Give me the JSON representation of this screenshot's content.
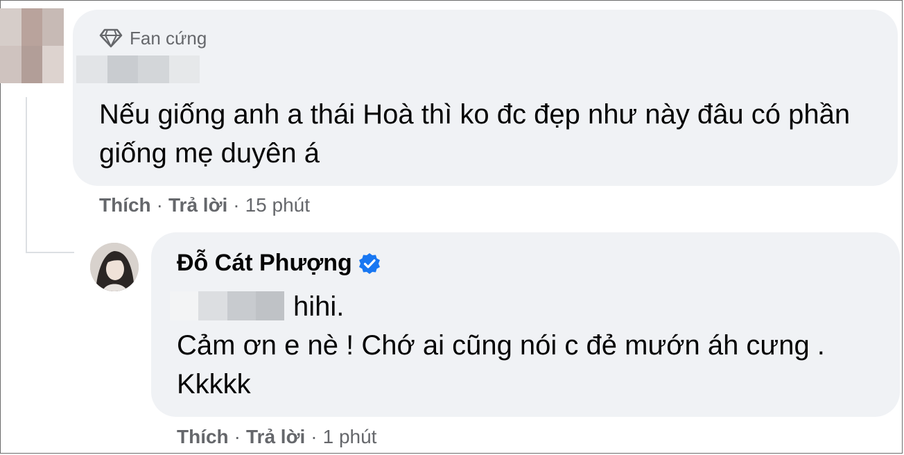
{
  "comment": {
    "badge_label": "Fan cứng",
    "badge_icon": "diamond-icon",
    "text": "Nếu giống anh a thái Hoà thì ko đc đẹp như này đâu có phần giống mẹ duyên á",
    "actions": {
      "like": "Thích",
      "reply": "Trả lời",
      "separator": "·",
      "time": "15 phút"
    }
  },
  "reply": {
    "author_name": "Đỗ Cát Phượng",
    "verified_icon": "verified-badge-icon",
    "line1": "hihi.",
    "line2": "Cảm ơn e nè ! Chớ ai cũng nói c đẻ mướn áh cưng . Kkkkk",
    "actions": {
      "like": "Thích",
      "reply": "Trả lời",
      "separator": "·",
      "time": "1 phút"
    }
  },
  "colors": {
    "bubble_bg": "#f0f2f5",
    "secondary_text": "#65676b",
    "verified_blue": "#1877f2",
    "thread_line": "#dcdfe3"
  }
}
